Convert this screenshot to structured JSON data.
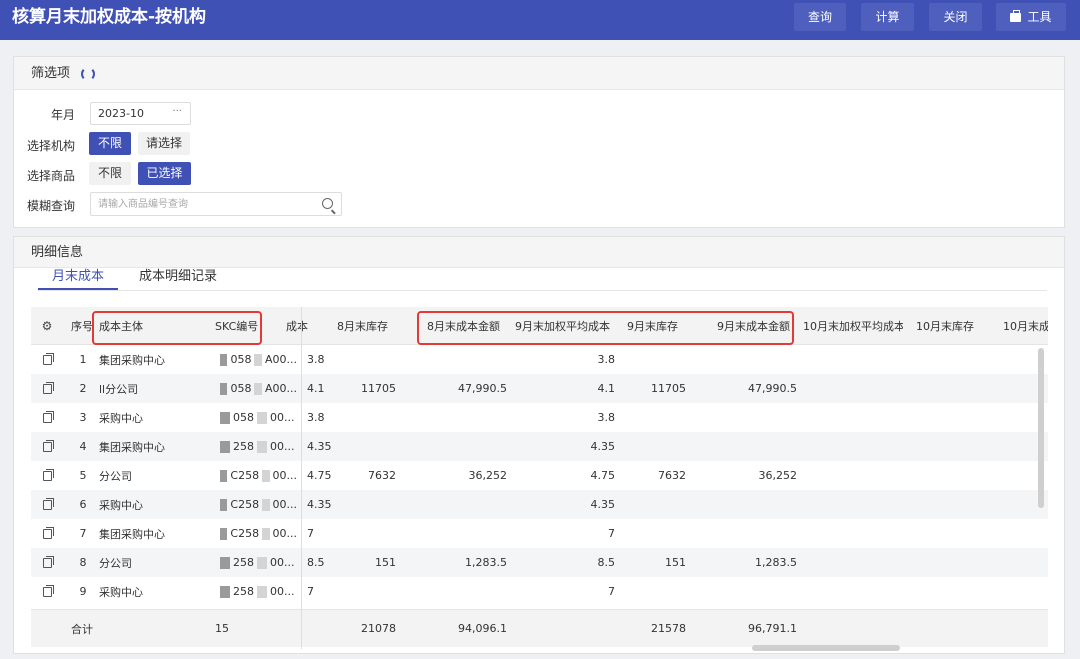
{
  "app": {
    "title": "核算月末加权成本-按机构",
    "buttons": {
      "query": "查询",
      "compute": "计算",
      "close": "关闭",
      "tools": "工具"
    }
  },
  "filter": {
    "title": "筛选项",
    "year_month_label": "年月",
    "year_month_value": "2023-10",
    "org_label": "选择机构",
    "org_unlimited": "不限",
    "org_choose": "请选择",
    "goods_label": "选择商品",
    "goods_unlimited": "不限",
    "goods_selected": "已选择",
    "fuzzy_label": "模糊查询",
    "search_placeholder": "请输入商品编号查询"
  },
  "detail": {
    "title": "明细信息",
    "tabs": [
      "月末成本",
      "成本明细记录"
    ]
  },
  "table": {
    "columns": {
      "seq": "序号",
      "subject": "成本主体",
      "skc": "SKC编号",
      "cost8_partial": "成本",
      "stock8": "8月末库存",
      "amt8": "8月末成本金额",
      "avg9": "9月末加权平均成本",
      "stock9": "9月末库存",
      "amt9": "9月末成本金额",
      "avg10": "10月末加权平均成本",
      "stock10": "10月末库存",
      "cost10_partial": "10月末成"
    },
    "rows": [
      {
        "seq": "1",
        "subject": "集团采购中心",
        "skc_a": "058",
        "skc_b": "A00...",
        "cost8": "3.8",
        "stock8": "",
        "amt8": "",
        "avg9": "3.8",
        "stock9": "",
        "amt9": ""
      },
      {
        "seq": "2",
        "subject": "ll分公司",
        "skc_a": "058",
        "skc_b": "A00...",
        "cost8": "4.1",
        "stock8": "11705",
        "amt8": "47,990.5",
        "avg9": "4.1",
        "stock9": "11705",
        "amt9": "47,990.5"
      },
      {
        "seq": "3",
        "subject": "采购中心",
        "skc_a": "058",
        "skc_b": "00...",
        "cost8": "3.8",
        "stock8": "",
        "amt8": "",
        "avg9": "3.8",
        "stock9": "",
        "amt9": ""
      },
      {
        "seq": "4",
        "subject": "集团采购中心",
        "skc_a": "258",
        "skc_b": "00...",
        "cost8": "4.35",
        "stock8": "",
        "amt8": "",
        "avg9": "4.35",
        "stock9": "",
        "amt9": ""
      },
      {
        "seq": "5",
        "subject": "分公司",
        "skc_a": "C258",
        "skc_b": "00...",
        "cost8": "4.75",
        "stock8": "7632",
        "amt8": "36,252",
        "avg9": "4.75",
        "stock9": "7632",
        "amt9": "36,252"
      },
      {
        "seq": "6",
        "subject": "采购中心",
        "skc_a": "C258",
        "skc_b": "00...",
        "cost8": "4.35",
        "stock8": "",
        "amt8": "",
        "avg9": "4.35",
        "stock9": "",
        "amt9": ""
      },
      {
        "seq": "7",
        "subject": "集团采购中心",
        "skc_a": "C258",
        "skc_b": "00...",
        "cost8": "7",
        "stock8": "",
        "amt8": "",
        "avg9": "7",
        "stock9": "",
        "amt9": ""
      },
      {
        "seq": "8",
        "subject": "分公司",
        "skc_a": "258",
        "skc_b": "00...",
        "cost8": "8.5",
        "stock8": "151",
        "amt8": "1,283.5",
        "avg9": "8.5",
        "stock9": "151",
        "amt9": "1,283.5"
      },
      {
        "seq": "9",
        "subject": "采购中心",
        "skc_a": "258",
        "skc_b": "00...",
        "cost8": "7",
        "stock8": "",
        "amt8": "",
        "avg9": "7",
        "stock9": "",
        "amt9": ""
      }
    ],
    "footer": {
      "label": "合计",
      "skc_count": "15",
      "stock8": "21078",
      "amt8": "94,096.1",
      "stock9": "21578",
      "amt9": "96,791.1"
    }
  },
  "colors": {
    "primary": "#3f51b5",
    "highlight": "#e53935"
  }
}
